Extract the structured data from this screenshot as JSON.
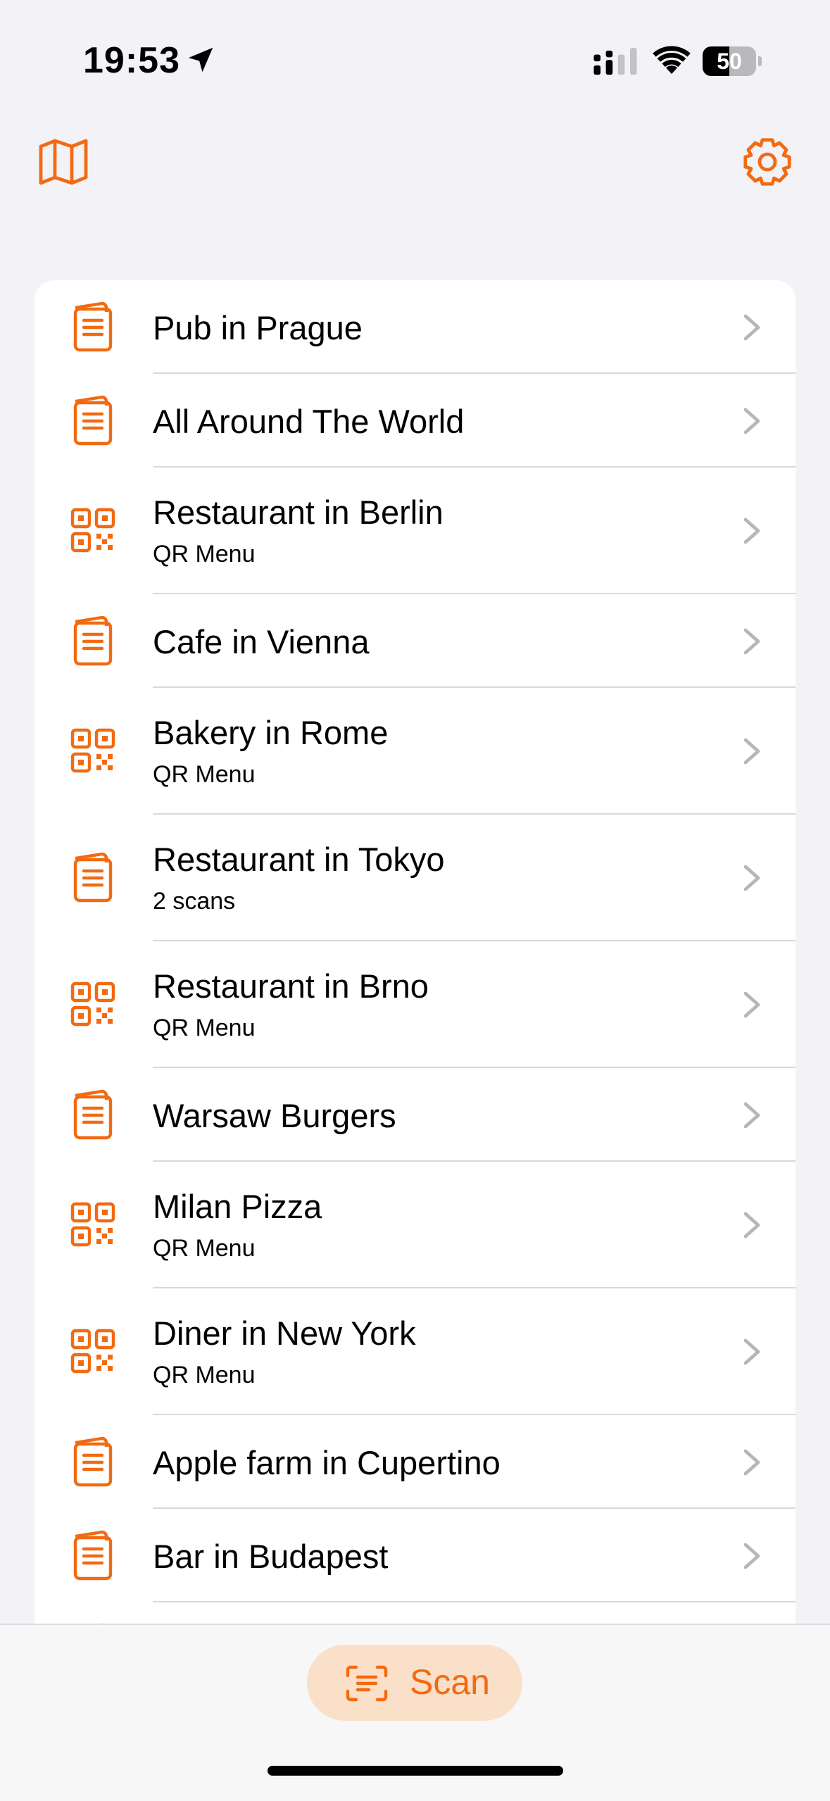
{
  "status_bar": {
    "time": "19:53",
    "battery": "50",
    "battery_level": 0.5
  },
  "colors": {
    "accent": "#f26a12",
    "background": "#f2f2f7",
    "card": "#ffffff",
    "chevron": "#b5b5ba",
    "scan_bg": "#fadfc9"
  },
  "toolbar": {
    "left_icon": "map-icon",
    "right_icon": "gear-icon"
  },
  "list": {
    "items": [
      {
        "title": "Pub in Prague",
        "subtitle": "",
        "icon": "menu-book-icon"
      },
      {
        "title": "All Around The World",
        "subtitle": "",
        "icon": "menu-book-icon"
      },
      {
        "title": "Restaurant in Berlin",
        "subtitle": "QR Menu",
        "icon": "qr-code-icon"
      },
      {
        "title": "Cafe in Vienna",
        "subtitle": "",
        "icon": "menu-book-icon"
      },
      {
        "title": "Bakery in Rome",
        "subtitle": "QR Menu",
        "icon": "qr-code-icon"
      },
      {
        "title": "Restaurant in Tokyo",
        "subtitle": "2 scans",
        "icon": "menu-book-icon"
      },
      {
        "title": "Restaurant in Brno",
        "subtitle": "QR Menu",
        "icon": "qr-code-icon"
      },
      {
        "title": "Warsaw Burgers",
        "subtitle": "",
        "icon": "menu-book-icon"
      },
      {
        "title": "Milan Pizza",
        "subtitle": "QR Menu",
        "icon": "qr-code-icon"
      },
      {
        "title": "Diner in New York",
        "subtitle": "QR Menu",
        "icon": "qr-code-icon"
      },
      {
        "title": "Apple farm in Cupertino",
        "subtitle": "",
        "icon": "menu-book-icon"
      },
      {
        "title": "Bar in Budapest",
        "subtitle": "",
        "icon": "menu-book-icon"
      }
    ]
  },
  "bottom_bar": {
    "scan_label": "Scan",
    "scan_icon": "scan-text-icon"
  }
}
